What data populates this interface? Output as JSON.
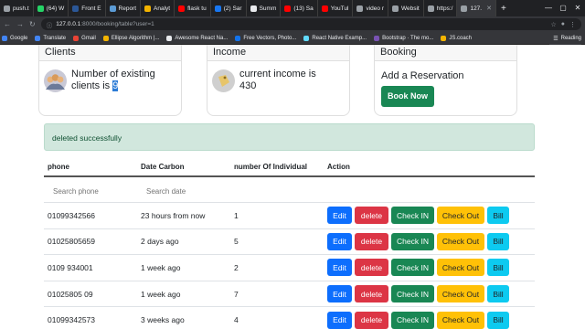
{
  "browser": {
    "tabs": [
      {
        "label": "push.t",
        "color": "#9aa0a6"
      },
      {
        "label": "(64) W",
        "color": "#25d366"
      },
      {
        "label": "Front E",
        "color": "#2b5797"
      },
      {
        "label": "Report",
        "color": "#5b9bd5"
      },
      {
        "label": "Analyt",
        "color": "#f4b400"
      },
      {
        "label": "flask tu",
        "color": "#ff0000"
      },
      {
        "label": "(2) Sar",
        "color": "#1877f2"
      },
      {
        "label": "Summ",
        "color": "#e8eaed"
      },
      {
        "label": "(13) Sa",
        "color": "#ff0000"
      },
      {
        "label": "YouTul",
        "color": "#ff0000"
      },
      {
        "label": "video r",
        "color": "#9aa0a6"
      },
      {
        "label": "Websit",
        "color": "#9aa0a6"
      },
      {
        "label": "https:/",
        "color": "#9aa0a6"
      },
      {
        "label": "127.",
        "color": "#9aa0a6",
        "active": true
      }
    ],
    "url_host": "127.0.0.1",
    "url_path": ":8000/booking/table?user=1",
    "bookmarks": [
      {
        "label": "Google",
        "color": "#4285f4"
      },
      {
        "label": "Translate",
        "color": "#4285f4"
      },
      {
        "label": "Gmail",
        "color": "#ea4335"
      },
      {
        "label": "Ellipse Algorithm |...",
        "color": "#f4b400"
      },
      {
        "label": "Awesome React Na...",
        "color": "#e8eaed"
      },
      {
        "label": "Free Vectors, Photo...",
        "color": "#1273eb"
      },
      {
        "label": "React Native Examp...",
        "color": "#61dafb"
      },
      {
        "label": "Bootstrap · The mo...",
        "color": "#7952b3"
      },
      {
        "label": "JS.coach",
        "color": "#f4b400"
      }
    ],
    "reading_list": "Reading"
  },
  "cards": {
    "clients": {
      "title": "Clients",
      "text_before": "Number of existing clients is ",
      "count": "9"
    },
    "income": {
      "title": "Income",
      "text": "current income is 430"
    },
    "booking": {
      "title": "Booking",
      "text": "Add a Reservation",
      "button": "Book Now"
    }
  },
  "alert": {
    "message": "deleted successfully"
  },
  "table": {
    "headers": [
      "phone",
      "Date Carbon",
      "number Of Individual",
      "Action"
    ],
    "search_phone_placeholder": "Search phone",
    "search_date_placeholder": "Search date",
    "rows": [
      {
        "phone": "01099342566",
        "date": "23 hours from now",
        "count": "1"
      },
      {
        "phone": "01025805659",
        "date": "2 days ago",
        "count": "5"
      },
      {
        "phone": "0109 934001",
        "date": "1 week ago",
        "count": "2"
      },
      {
        "phone": "01025805 09",
        "date": "1 week ago",
        "count": "7"
      },
      {
        "phone": "01099342573",
        "date": "3 weeks ago",
        "count": "4"
      }
    ],
    "actions": {
      "edit": "Edit",
      "delete": "delete",
      "check_in": "Check IN",
      "check_out": "Check Out",
      "bill": "Bill"
    }
  },
  "colors": {
    "primary": "#0d6efd",
    "danger": "#dc3545",
    "success": "#198754",
    "warning": "#ffc107",
    "info": "#0dcaf0"
  }
}
